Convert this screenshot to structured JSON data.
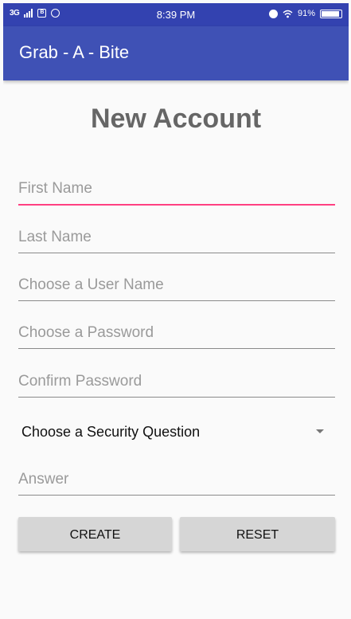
{
  "status_bar": {
    "network": "3G",
    "box_glyph": "B",
    "time": "8:39 PM",
    "battery": "91%",
    "icons": [
      "signal-icon",
      "notification-icon",
      "whatsapp-icon",
      "alarm-icon",
      "wifi-icon",
      "battery-icon"
    ]
  },
  "app_bar": {
    "title": "Grab - A - Bite",
    "color": "#3f51b5",
    "status_color": "#3342b0"
  },
  "page": {
    "title": "New Account"
  },
  "form": {
    "first_name": {
      "placeholder": "First Name",
      "value": ""
    },
    "last_name": {
      "placeholder": "Last Name",
      "value": ""
    },
    "user_name": {
      "placeholder": "Choose a User Name",
      "value": ""
    },
    "password": {
      "placeholder": "Choose a Password",
      "value": ""
    },
    "confirm_password": {
      "placeholder": "Confirm Password",
      "value": ""
    },
    "security_question": {
      "selected": "Choose a Security Question"
    },
    "answer": {
      "placeholder": "Answer",
      "value": ""
    }
  },
  "buttons": {
    "create": "CREATE",
    "reset": "RESET"
  },
  "colors": {
    "accent": "#ff4081",
    "background": "#fafafa",
    "button": "#d6d6d6"
  }
}
